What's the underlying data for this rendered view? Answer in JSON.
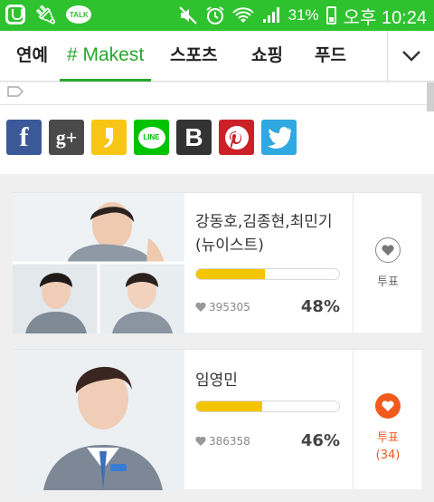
{
  "status_bar": {
    "talk_label": "TALK",
    "battery_pct": "31%",
    "time": "오후 10:24"
  },
  "tabs": [
    {
      "label": "연예"
    },
    {
      "label": "# Makest",
      "active": true
    },
    {
      "label": "스포츠"
    },
    {
      "label": "쇼핑"
    },
    {
      "label": "푸드"
    }
  ],
  "share": [
    {
      "name": "facebook",
      "glyph": "f",
      "color": "#3b5998"
    },
    {
      "name": "google-plus",
      "glyph": "g+",
      "color": "#4a4a4a"
    },
    {
      "name": "kakaostory",
      "glyph": "",
      "color": "#f9c514"
    },
    {
      "name": "line",
      "glyph": "LINE",
      "color": "#00c300"
    },
    {
      "name": "band",
      "glyph": "B",
      "color": "#333333"
    },
    {
      "name": "pinterest",
      "glyph": "",
      "color": "#cb2027"
    },
    {
      "name": "twitter",
      "glyph": "",
      "color": "#30a8e2"
    }
  ],
  "candidates": [
    {
      "name_line1": "강동호,김종현,최민기",
      "name_line2": "(뉴이스트)",
      "progress": 0.48,
      "votes": "395305",
      "percent": "48%",
      "vote_label": "투표",
      "vote_count": "",
      "voted": false
    },
    {
      "name_line1": "임영민",
      "name_line2": "",
      "progress": 0.46,
      "votes": "386358",
      "percent": "46%",
      "vote_label": "투표",
      "vote_count": "(34)",
      "voted": true
    }
  ],
  "colors": {
    "accent_green": "#27a82e",
    "status_green": "#2fc22f",
    "bar_yellow": "#f5c400",
    "vote_orange": "#f25a1b"
  }
}
